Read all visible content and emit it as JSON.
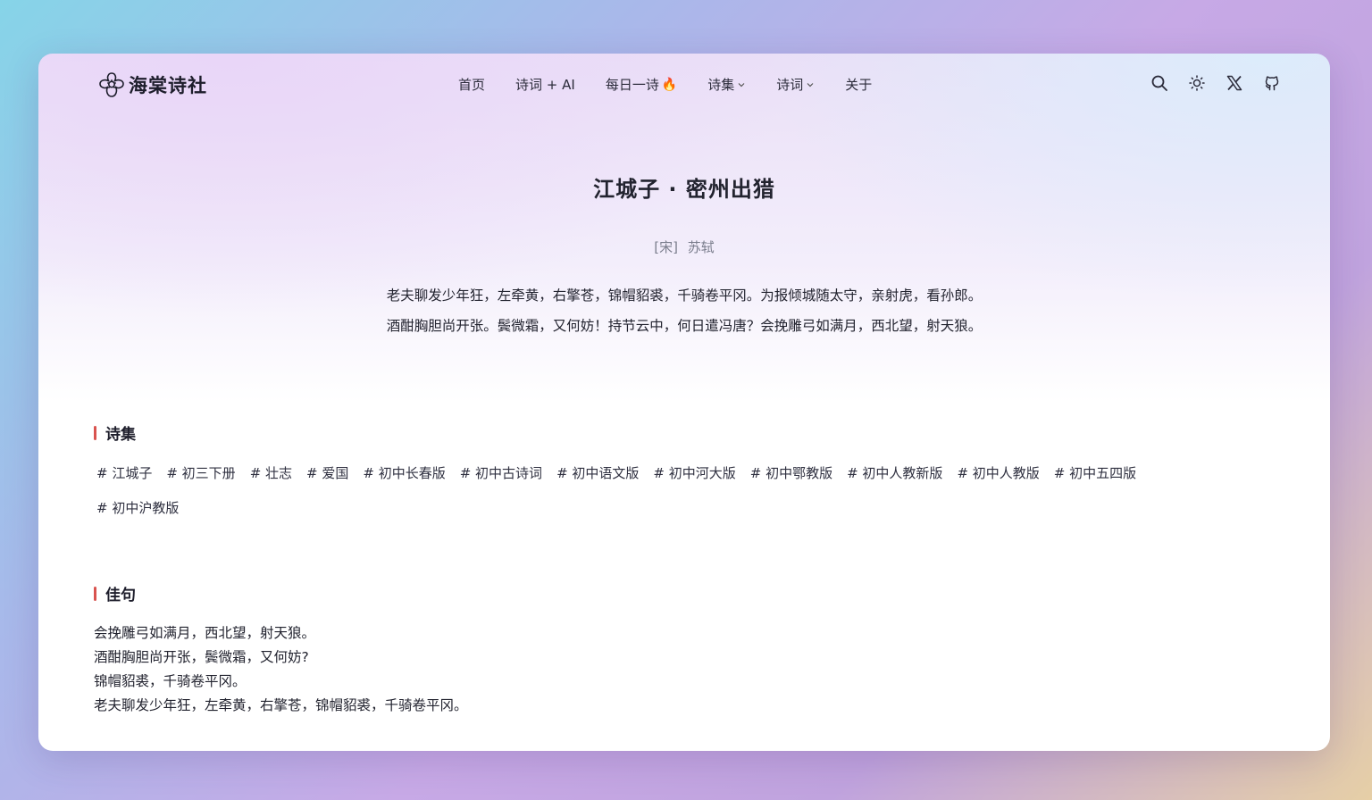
{
  "header": {
    "brand": "海棠诗社",
    "logo_icon": "flower-icon",
    "nav": [
      {
        "label": "首页"
      },
      {
        "label": "诗词 + AI"
      },
      {
        "label": "每日一诗",
        "badge_icon": "fire-icon"
      },
      {
        "label": "诗集",
        "dropdown": true
      },
      {
        "label": "诗词",
        "dropdown": true
      },
      {
        "label": "关于"
      }
    ],
    "tools": [
      "search-icon",
      "sun-icon",
      "x-logo-icon",
      "github-icon"
    ]
  },
  "poem": {
    "title": "江城子 · 密州出猎",
    "dynasty": "[宋]",
    "author": "苏轼",
    "lines": [
      "老夫聊发少年狂，左牵黄，右擎苍，锦帽貂裘，千骑卷平冈。为报倾城随太守，亲射虎，看孙郎。",
      "酒酣胸胆尚开张。鬓微霜，又何妨！持节云中，何日遣冯唐？会挽雕弓如满月，西北望，射天狼。"
    ]
  },
  "collections": {
    "heading": "诗集",
    "tags": [
      "# 江城子",
      "# 初三下册",
      "# 壮志",
      "# 爱国",
      "# 初中长春版",
      "# 初中古诗词",
      "# 初中语文版",
      "# 初中河大版",
      "# 初中鄂教版",
      "# 初中人教新版",
      "# 初中人教版",
      "# 初中五四版",
      "# 初中沪教版"
    ]
  },
  "famous_lines": {
    "heading": "佳句",
    "lines": [
      "会挽雕弓如满月，西北望，射天狼。",
      "酒酣胸胆尚开张，鬓微霜，又何妨?",
      "锦帽貂裘，千骑卷平冈。",
      "老夫聊发少年狂，左牵黄，右擎苍，锦帽貂裘，千骑卷平冈。"
    ]
  },
  "colors": {
    "accent_bar": "#d9534f",
    "text": "#22232f",
    "muted": "#7a7d8c"
  }
}
